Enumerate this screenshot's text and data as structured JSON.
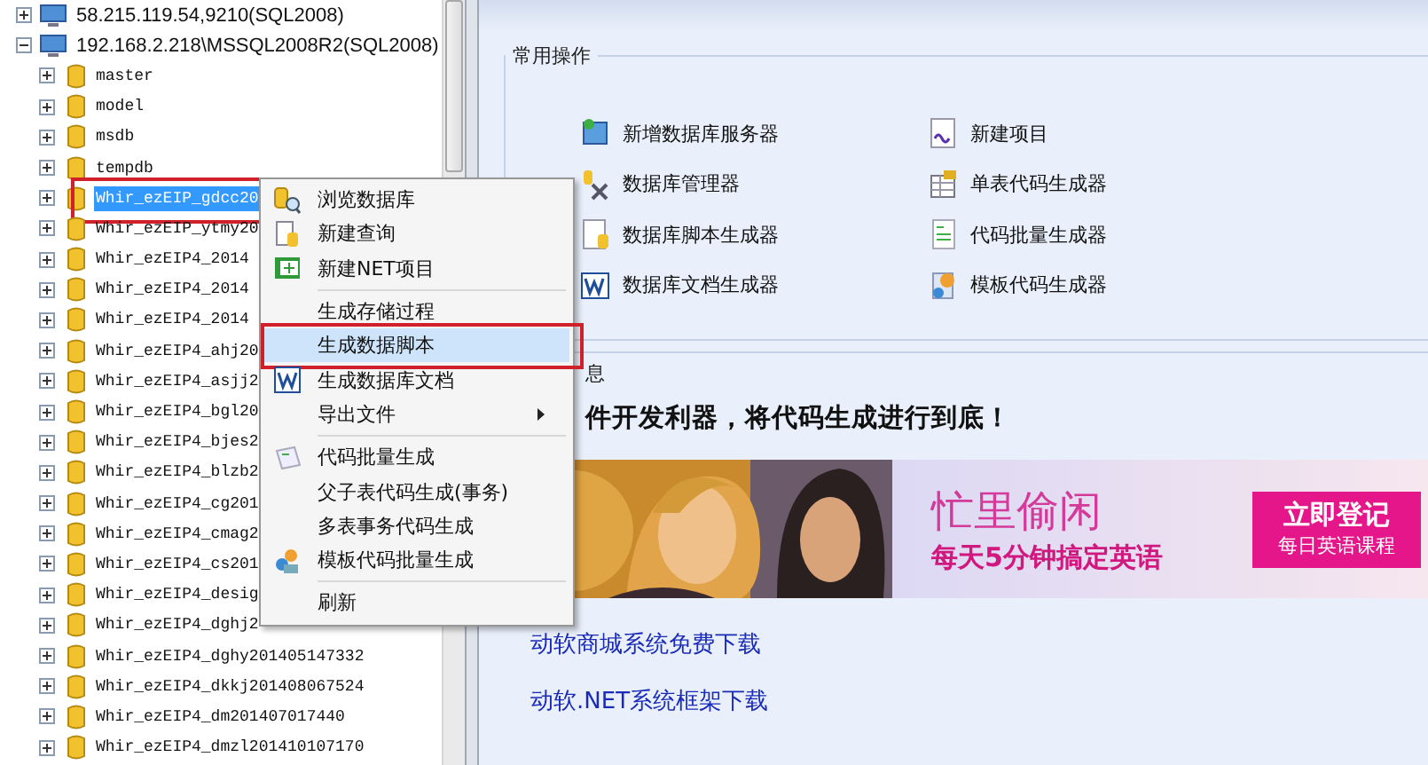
{
  "tree": {
    "servers": [
      {
        "label": "58.215.119.54,9210(SQL2008)",
        "expanded": false
      },
      {
        "label": "192.168.2.218\\MSSQL2008R2(SQL2008)",
        "expanded": true,
        "children": [
          {
            "label": "master",
            "expanded": false,
            "selected": false,
            "annotated": false
          },
          {
            "label": "model",
            "expanded": false,
            "selected": false,
            "annotated": false
          },
          {
            "label": "msdb",
            "expanded": false,
            "selected": false,
            "annotated": false
          },
          {
            "label": "tempdb",
            "expanded": false,
            "selected": false,
            "annotated": false
          },
          {
            "label": "Whir_ezEIP_gdcc20",
            "expanded": false,
            "selected": true,
            "annotated": true
          },
          {
            "label": "Whir_ezEIP_ytmy20",
            "expanded": false,
            "selected": false,
            "annotated": false
          },
          {
            "label": "Whir_ezEIP4_2014",
            "expanded": false,
            "selected": false,
            "annotated": false
          },
          {
            "label": "Whir_ezEIP4_2014",
            "expanded": false,
            "selected": false,
            "annotated": false
          },
          {
            "label": "Whir_ezEIP4_2014",
            "expanded": false,
            "selected": false,
            "annotated": false
          },
          {
            "label": "Whir_ezEIP4_ahj20",
            "expanded": false,
            "selected": false,
            "annotated": false
          },
          {
            "label": "Whir_ezEIP4_asjj2",
            "expanded": false,
            "selected": false,
            "annotated": false
          },
          {
            "label": "Whir_ezEIP4_bgl20",
            "expanded": false,
            "selected": false,
            "annotated": false
          },
          {
            "label": "Whir_ezEIP4_bjes2",
            "expanded": false,
            "selected": false,
            "annotated": false
          },
          {
            "label": "Whir_ezEIP4_blzb2",
            "expanded": false,
            "selected": false,
            "annotated": false
          },
          {
            "label": "Whir_ezEIP4_cg201",
            "expanded": false,
            "selected": false,
            "annotated": false
          },
          {
            "label": "Whir_ezEIP4_cmag2",
            "expanded": false,
            "selected": false,
            "annotated": false
          },
          {
            "label": "Whir_ezEIP4_cs201",
            "expanded": false,
            "selected": false,
            "annotated": false
          },
          {
            "label": "Whir_ezEIP4_desig",
            "expanded": false,
            "selected": false,
            "annotated": false
          },
          {
            "label": "Whir_ezEIP4_dghj2",
            "expanded": false,
            "selected": false,
            "annotated": false
          },
          {
            "label": "Whir_ezEIP4_dghy201405147332",
            "expanded": false,
            "selected": false,
            "annotated": false
          },
          {
            "label": "Whir_ezEIP4_dkkj201408067524",
            "expanded": false,
            "selected": false,
            "annotated": false
          },
          {
            "label": "Whir_ezEIP4_dm201407017440",
            "expanded": false,
            "selected": false,
            "annotated": false
          },
          {
            "label": "Whir_ezEIP4_dmzl201410107170",
            "expanded": false,
            "selected": false,
            "annotated": false
          }
        ]
      }
    ]
  },
  "context_menu": {
    "groups": [
      {
        "items": [
          {
            "label": "浏览数据库",
            "selected": false,
            "annotated": false,
            "submenu": false
          },
          {
            "label": "新建查询",
            "selected": false,
            "annotated": false,
            "submenu": false
          },
          {
            "label": "新建NET项目",
            "selected": false,
            "annotated": false,
            "submenu": false
          }
        ]
      },
      {
        "items": [
          {
            "label": "生成存储过程",
            "selected": false,
            "annotated": false,
            "submenu": false
          },
          {
            "label": "生成数据脚本",
            "selected": true,
            "annotated": true,
            "submenu": false
          },
          {
            "label": "生成数据库文档",
            "selected": false,
            "annotated": false,
            "submenu": false
          },
          {
            "label": "导出文件",
            "selected": false,
            "annotated": false,
            "submenu": true
          }
        ]
      },
      {
        "items": [
          {
            "label": "代码批量生成",
            "selected": false,
            "annotated": false,
            "submenu": false
          },
          {
            "label": "父子表代码生成(事务)",
            "selected": false,
            "annotated": false,
            "submenu": false
          },
          {
            "label": "多表事务代码生成",
            "selected": false,
            "annotated": false,
            "submenu": false
          },
          {
            "label": "模板代码批量生成",
            "selected": false,
            "annotated": false,
            "submenu": false
          }
        ]
      },
      {
        "items": [
          {
            "label": "刷新",
            "selected": false,
            "annotated": false,
            "submenu": false
          }
        ]
      }
    ]
  },
  "quick_actions": {
    "title": "常用操作",
    "items": [
      "新增数据库服务器",
      "新建项目",
      "数据库管理器",
      "单表代码生成器",
      "数据库脚本生成器",
      "代码批量生成器",
      "数据库文档生成器",
      "模板代码生成器"
    ]
  },
  "info": {
    "title": "息",
    "headline": "件开发利器，将代码生成进行到底！",
    "banner": {
      "title": "忙里偷闲",
      "subtitle": "每天5分钟搞定英语",
      "button": "立即登记",
      "button_caption": "每日英语课程"
    },
    "links": [
      "动软商城系统免费下载",
      "动软.NET系统框架下载"
    ]
  }
}
